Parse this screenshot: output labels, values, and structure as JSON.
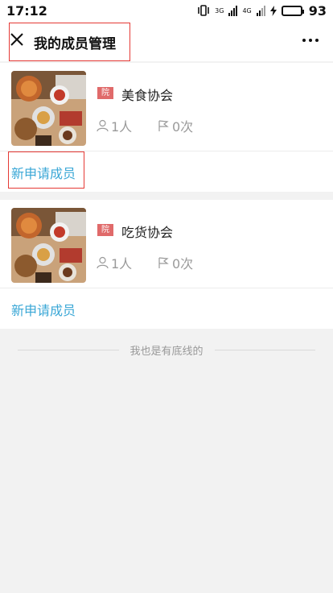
{
  "status_bar": {
    "time": "17:12",
    "battery_percent": "93",
    "battery_level": 0.93,
    "network_labels": [
      "3G",
      "4G"
    ]
  },
  "nav": {
    "title": "我的成员管理"
  },
  "organizations": [
    {
      "badge": "院",
      "name": "美食协会",
      "members": "1人",
      "times": "0次",
      "apply_label": "新申请成员"
    },
    {
      "badge": "院",
      "name": "吃货协会",
      "members": "1人",
      "times": "0次",
      "apply_label": "新申请成员"
    }
  ],
  "footer": {
    "text": "我也是有底线的"
  },
  "colors": {
    "link": "#3aa7d6",
    "badge": "#e06a6a",
    "highlight_box": "#e53935",
    "battery": "#2bb24c"
  }
}
